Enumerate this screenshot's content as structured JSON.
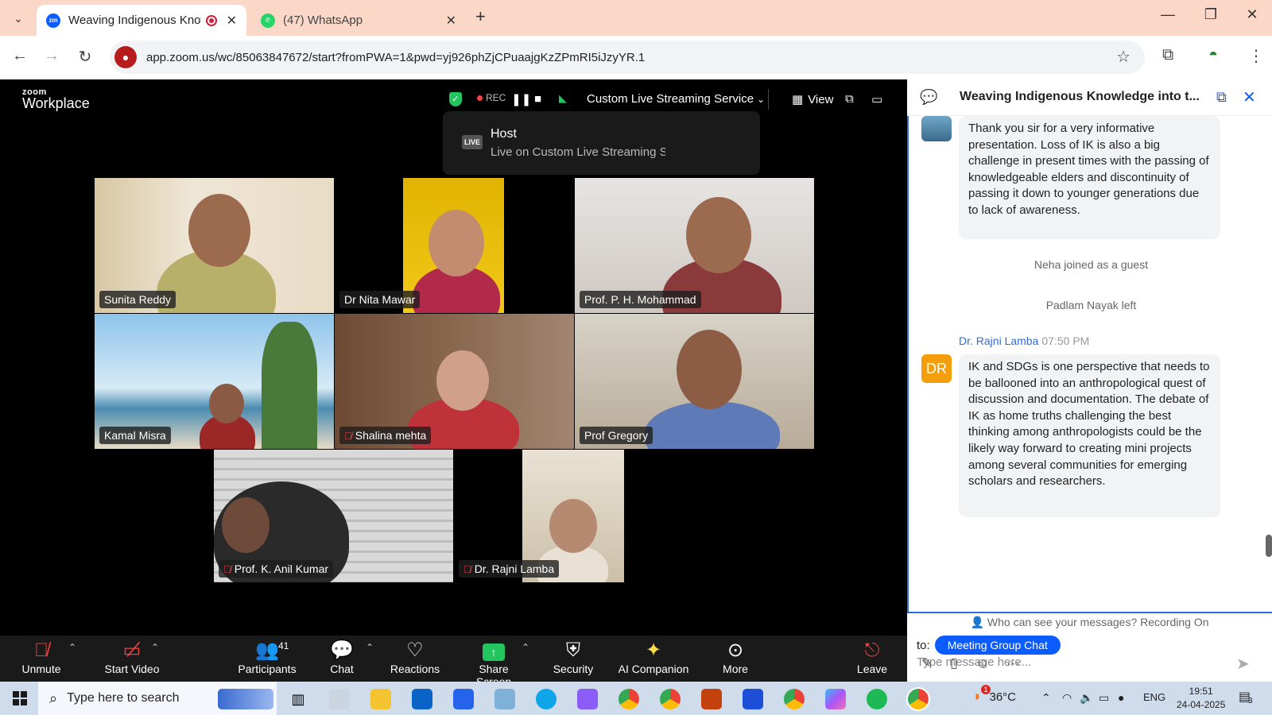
{
  "browser": {
    "tabs": [
      {
        "title": "Weaving Indigenous Knowle",
        "favicon": "zm"
      },
      {
        "title": "(47) WhatsApp"
      }
    ],
    "url": "app.zoom.us/wc/85063847672/start?fromPWA=1&pwd=yj926phZjCPuaajgKzZPmRI5iJzyYR.1"
  },
  "zoom": {
    "logo_small": "zoom",
    "logo_big": "Workplace",
    "rec_label": "REC",
    "stream_label": "Custom Live Streaming Service",
    "view_label": "View",
    "live_popup": {
      "badge": "LIVE",
      "role": "Host",
      "status": "Live on Custom Live Streaming Se"
    },
    "participants": [
      {
        "name": "Sunita Reddy",
        "muted": false
      },
      {
        "name": "Dr Nita Mawar",
        "muted": false
      },
      {
        "name": "Prof. P. H. Mohammad",
        "muted": false
      },
      {
        "name": "Kamal Misra",
        "muted": false
      },
      {
        "name": "Shalina mehta",
        "muted": true
      },
      {
        "name": "Prof Gregory",
        "muted": false
      },
      {
        "name": "Prof. K. Anil Kumar",
        "muted": true
      },
      {
        "name": "Dr. Rajni Lamba",
        "muted": true
      }
    ],
    "toolbar": {
      "unmute": "Unmute",
      "start_video": "Start Video",
      "participants": "Participants",
      "participant_count": "41",
      "chat": "Chat",
      "reactions": "Reactions",
      "share_screen": "Share Screen",
      "security": "Security",
      "ai_companion": "AI Companion",
      "more": "More",
      "leave": "Leave"
    }
  },
  "chat": {
    "title": "Weaving Indigenous Knowledge into t...",
    "messages": [
      {
        "text": "Thank you sir for a very informative presentation.   Loss of IK is also a big challenge in present times with the passing of knowledgeable elders and discontinuity of passing it down to younger generations due to lack of awareness."
      },
      {
        "system": "Neha joined as a guest"
      },
      {
        "system": "Padlam Nayak left"
      },
      {
        "sender": "Dr. Rajni Lamba",
        "initials": "DR",
        "time": "07:50 PM",
        "text": "IK and SDGs is one perspective that needs to be ballooned into an anthropological quest of discussion and documentation. The debate of IK as home truths challenging the best thinking among anthropologists could be the likely way forward to creating mini projects among several communities for emerging scholars and researchers."
      }
    ],
    "visibility_note": "Who can see your messages? Recording On",
    "to_label": "to:",
    "recipient": "Meeting Group Chat",
    "input_placeholder": "Type message here..."
  },
  "taskbar": {
    "search_placeholder": "Type here to search",
    "weather": "36°C",
    "weather_alert": "1",
    "language": "ENG",
    "time": "19:51",
    "date": "24-04-2025",
    "notification_count": "3"
  },
  "colors": {
    "zoom_blue": "#0b5cff",
    "speaker_border": "#d1e25b",
    "mute_red": "#ef4444",
    "share_green": "#22c55e"
  }
}
